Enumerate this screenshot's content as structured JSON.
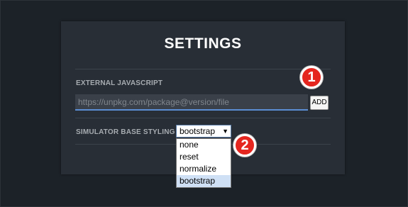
{
  "settings": {
    "title": "SETTINGS",
    "external_js": {
      "label": "EXTERNAL JAVASCRIPT",
      "input_value": "",
      "input_placeholder": "https://unpkg.com/package@version/file",
      "add_label": "ADD"
    },
    "base_styling": {
      "label": "SIMULATOR BASE STYLING",
      "selected": "bootstrap",
      "arrow": "▼",
      "options": [
        "none",
        "reset",
        "normalize",
        "bootstrap"
      ]
    }
  },
  "annotations": {
    "marker_1": "1",
    "marker_2": "2"
  },
  "colors": {
    "background": "#1c2228",
    "panel": "#282e36",
    "input_underline": "#5b8ed4",
    "marker": "#e5261f",
    "selected_option": "#cfe0f5"
  }
}
